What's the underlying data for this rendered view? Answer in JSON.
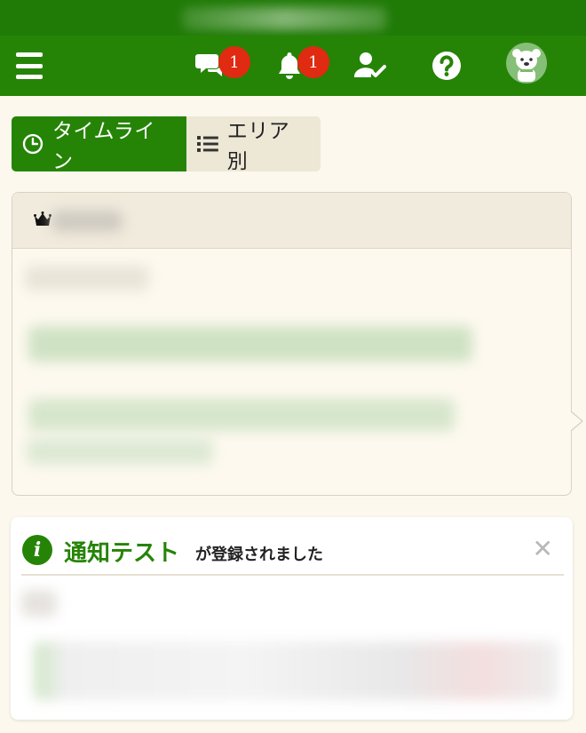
{
  "header": {
    "menu_icon": "hamburger-menu-icon",
    "messages_badge": "1",
    "notifications_badge": "1",
    "icons": [
      "chat-bubbles-icon",
      "bell-icon",
      "user-check-icon",
      "question-circle-icon",
      "avatar-icon"
    ]
  },
  "tabs": {
    "timeline_label": "タイムライン",
    "area_label": "エリア別"
  },
  "notification": {
    "title": "通知テスト",
    "suffix": "が登録されました",
    "close_symbol": "✕"
  },
  "colors": {
    "brand_green": "#258406",
    "topbar_green": "#1f7a06",
    "badge_red": "#e02a12",
    "page_background": "#fcf8ee"
  }
}
